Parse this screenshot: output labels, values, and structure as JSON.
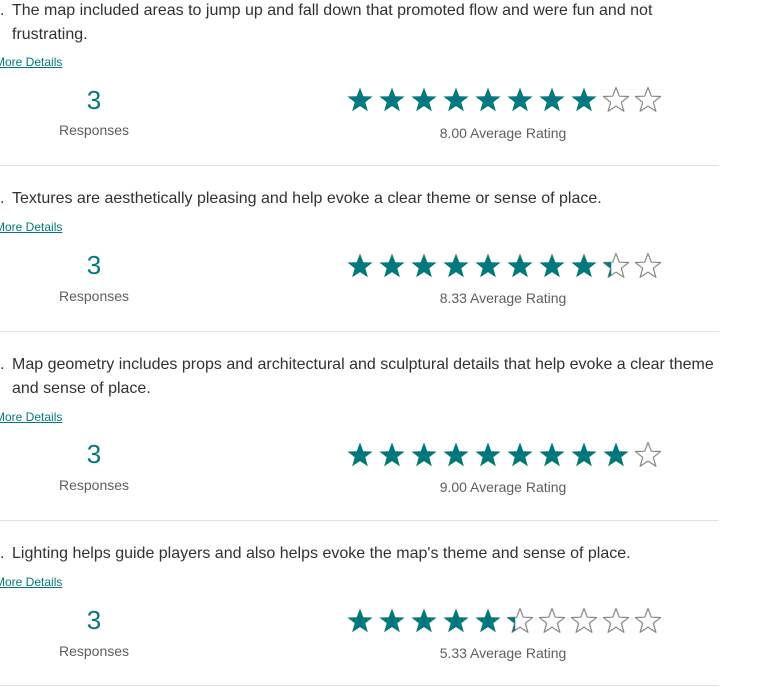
{
  "accent_color": "#03787c",
  "max_rating": 10,
  "questions": [
    {
      "number": ".",
      "text": "The map included areas to jump up and fall down that promoted flow and were fun and not frustrating.",
      "more_details": "More Details",
      "responses": "3",
      "responses_label": "Responses",
      "average": 8.0,
      "average_label": "8.00 Average Rating"
    },
    {
      "number": ".",
      "text": "Textures are aesthetically pleasing and help evoke a clear theme or sense of place.",
      "more_details": "More Details",
      "responses": "3",
      "responses_label": "Responses",
      "average": 8.33,
      "average_label": "8.33 Average Rating"
    },
    {
      "number": ".",
      "text": "Map geometry includes props and architectural and sculptural details that help evoke a clear theme and sense of place.",
      "more_details": "More Details",
      "responses": "3",
      "responses_label": "Responses",
      "average": 9.0,
      "average_label": "9.00 Average Rating"
    },
    {
      "number": ".",
      "text": "Lighting helps guide players and also helps evoke the map's theme and sense of place.",
      "more_details": "More Details",
      "responses": "3",
      "responses_label": "Responses",
      "average": 5.33,
      "average_label": "5.33 Average Rating"
    }
  ]
}
